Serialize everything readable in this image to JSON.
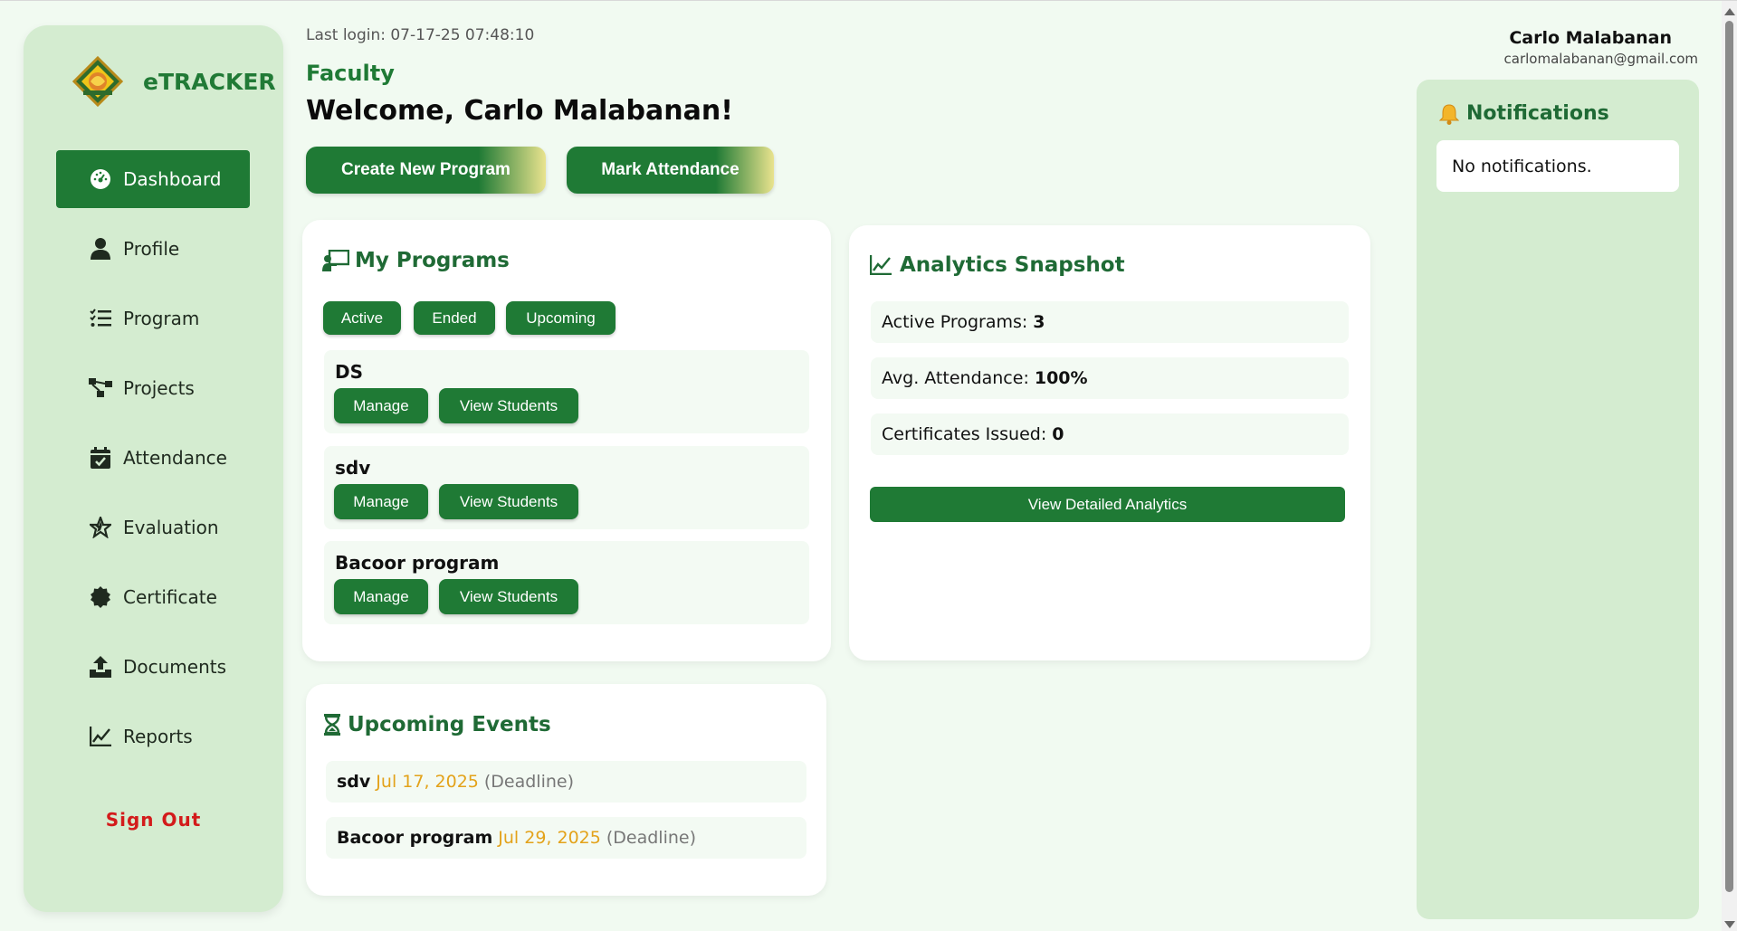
{
  "sidebar": {
    "brand": "eTRACKER",
    "items": [
      {
        "label": "Dashboard",
        "icon": "dashboard-gauge-icon"
      },
      {
        "label": "Profile",
        "icon": "user-icon"
      },
      {
        "label": "Program",
        "icon": "list-check-icon"
      },
      {
        "label": "Projects",
        "icon": "project-diagram-icon"
      },
      {
        "label": "Attendance",
        "icon": "calendar-check-icon"
      },
      {
        "label": "Evaluation",
        "icon": "star-icon"
      },
      {
        "label": "Certificate",
        "icon": "certificate-badge-icon"
      },
      {
        "label": "Documents",
        "icon": "upload-icon"
      },
      {
        "label": "Reports",
        "icon": "chart-line-icon"
      }
    ],
    "sign_out": "Sign Out"
  },
  "header": {
    "last_login": "Last login: 07-17-25 07:48:10",
    "role": "Faculty",
    "welcome": "Welcome, Carlo Malabanan!",
    "create_program": "Create New Program",
    "mark_attendance": "Mark Attendance",
    "user_name": "Carlo Malabanan",
    "user_email": "carlomalabanan@gmail.com"
  },
  "programs": {
    "title": "My Programs",
    "filters": [
      "Active",
      "Ended",
      "Upcoming"
    ],
    "items": [
      {
        "name": "DS",
        "manage": "Manage",
        "view": "View Students"
      },
      {
        "name": "sdv",
        "manage": "Manage",
        "view": "View Students"
      },
      {
        "name": "Bacoor program",
        "manage": "Manage",
        "view": "View Students"
      }
    ]
  },
  "analytics": {
    "title": "Analytics Snapshot",
    "stats": [
      {
        "label": "Active Programs:",
        "value": "3"
      },
      {
        "label": "Avg. Attendance:",
        "value": "100%"
      },
      {
        "label": "Certificates Issued:",
        "value": "0"
      }
    ],
    "button": "View Detailed Analytics"
  },
  "events": {
    "title": "Upcoming Events",
    "items": [
      {
        "name": "sdv",
        "date": "Jul 17, 2025",
        "tag": "(Deadline)"
      },
      {
        "name": "Bacoor program",
        "date": "Jul 29, 2025",
        "tag": "(Deadline)"
      }
    ]
  },
  "notifications": {
    "title": "Notifications",
    "empty": "No notifications."
  },
  "colors": {
    "primary": "#1f7a35",
    "sidebar_bg": "#d4ecd0",
    "page_bg": "#f1faf1",
    "accent_date": "#e3a21a",
    "sign_out": "#d31b1b"
  }
}
